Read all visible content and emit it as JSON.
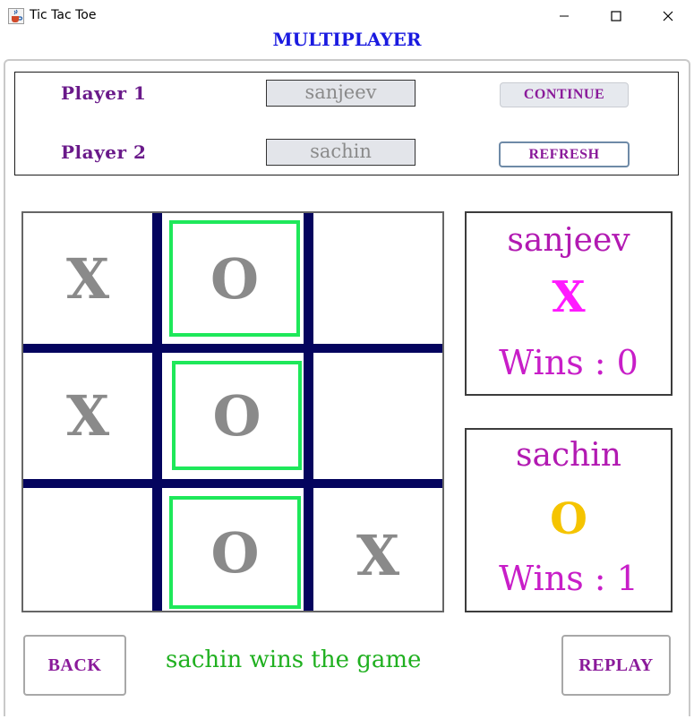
{
  "window": {
    "title": "Tic Tac Toe"
  },
  "heading": "MULTIPLAYER",
  "players": {
    "p1_label": "Player 1",
    "p1_value": "sanjeev",
    "p2_label": "Player 2",
    "p2_value": "sachin",
    "continue_label": "CONTINUE",
    "refresh_label": "REFRESH"
  },
  "board": {
    "cells": [
      "X",
      "O",
      "",
      "X",
      "O",
      "",
      "",
      "O",
      "X"
    ],
    "winning_cells": [
      1,
      4,
      7
    ]
  },
  "scores": {
    "p1": {
      "name": "sanjeev",
      "symbol": "X",
      "wins": "Wins : 0",
      "symbol_color": "#ff1aff"
    },
    "p2": {
      "name": "sachin",
      "symbol": "O",
      "wins": "Wins : 1",
      "symbol_color": "#f5c400"
    }
  },
  "footer": {
    "back_label": "BACK",
    "status": "sachin wins the game",
    "replay_label": "REPLAY"
  },
  "colors": {
    "heading": "#1a1ae0",
    "grid": "#04045e",
    "win_outline": "#1ee85a",
    "status": "#20b020"
  },
  "icons": {
    "app": "java-cup-icon",
    "minimize": "minimize-icon",
    "maximize": "maximize-icon",
    "close": "close-icon"
  }
}
